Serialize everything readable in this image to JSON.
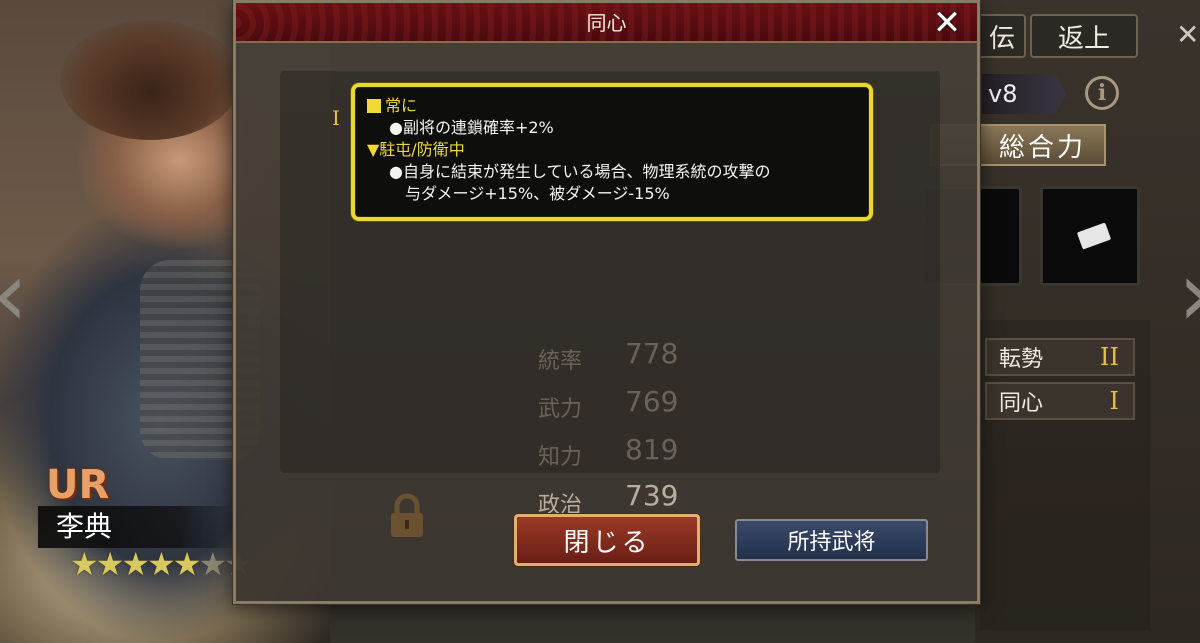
{
  "modal": {
    "title": "同心",
    "close_symbol": "✕",
    "skill_rank_marker": "I",
    "tooltip": {
      "section1_title": "常に",
      "section1_line": "●副将の連鎖確率+2%",
      "section2_title": "▼駐屯/防衛中",
      "section2_line1": "●自身に結束が発生している場合、物理系統の攻撃の",
      "section2_line2": "与ダメージ+15%、被ダメージ-15%"
    },
    "buttons": {
      "close_label": "閉じる",
      "owned_generals_label": "所持武将"
    }
  },
  "background": {
    "return_tab": "返上",
    "partial_tab": "伝",
    "level_badge": "v8",
    "combine_button": "総合力",
    "info_symbol": "i",
    "skills": [
      {
        "name": "転勢",
        "rank": "II"
      },
      {
        "name": "同心",
        "rank": "I"
      }
    ],
    "faded_stats": [
      {
        "label": "統率",
        "value": "778"
      },
      {
        "label": "武力",
        "value": "769"
      },
      {
        "label": "知力",
        "value": "819"
      },
      {
        "label": "政治",
        "value": "739"
      }
    ],
    "general": {
      "rarity": "UR",
      "name": "李典",
      "stars_filled": 5,
      "stars_total": 7
    }
  },
  "colors": {
    "tooltip_border": "#e8d830",
    "header_red": "#6a1014",
    "close_button": "#9a3a28",
    "owned_button": "#3a4a6a",
    "accent_gold": "#f0d838"
  }
}
